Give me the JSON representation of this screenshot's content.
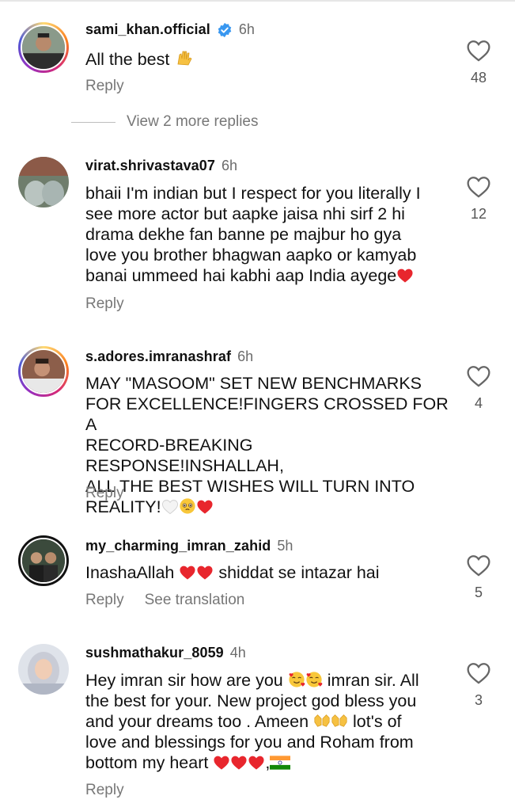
{
  "comments": [
    {
      "username": "sami_khan.official",
      "verified": true,
      "time": "6h",
      "text": "All the best",
      "emoji": "raising-hands",
      "actions": [
        "Reply"
      ],
      "likes": "48",
      "more_replies": "View 2 more replies"
    },
    {
      "username": "virat.shrivastava07",
      "time": "6h",
      "lines": [
        "bhaii I'm indian but I respect for you literally I",
        "see more actor but aapke jaisa nhi sirf 2 hi",
        "drama dekhe fan banne pe majbur ho gya",
        "love you brother bhagwan aapko or kamyab",
        "banai ummeed hai kabhi aap India ayege"
      ],
      "actions": [
        "Reply"
      ],
      "likes": "12"
    },
    {
      "username": "s.adores.imranashraf",
      "time": "6h",
      "lines": [
        "MAY \"MASOOM\" SET NEW BENCHMARKS",
        "FOR EXCELLENCE!FINGERS CROSSED FOR A",
        "RECORD-BREAKING RESPONSE!INSHALLAH,",
        "ALL THE BEST WISHES WILL TURN INTO",
        "REALITY!"
      ],
      "actions": [
        "Reply"
      ],
      "likes": "4"
    },
    {
      "username": "my_charming_imran_zahid",
      "time": "5h",
      "text_start": "InashaAllah",
      "text_end": "shiddat se intazar hai",
      "actions": [
        "Reply",
        "See translation"
      ],
      "likes": "5"
    },
    {
      "username": "sushmathakur_8059",
      "time": "4h",
      "line1_a": "Hey imran sir how are you",
      "line1_b": "imran sir. All",
      "line2": "the best for your. New project god bless you",
      "line3": "and your dreams too . Ameen",
      "line4_b": "lot's of",
      "line4": "love and blessings for you and Roham from",
      "line5": "bottom my heart",
      "line5_sep": ",",
      "actions": [
        "Reply"
      ],
      "likes": "3"
    }
  ],
  "colors": {
    "heart": "#e8262d",
    "verified": "#3897f0",
    "muted": "#777777"
  }
}
